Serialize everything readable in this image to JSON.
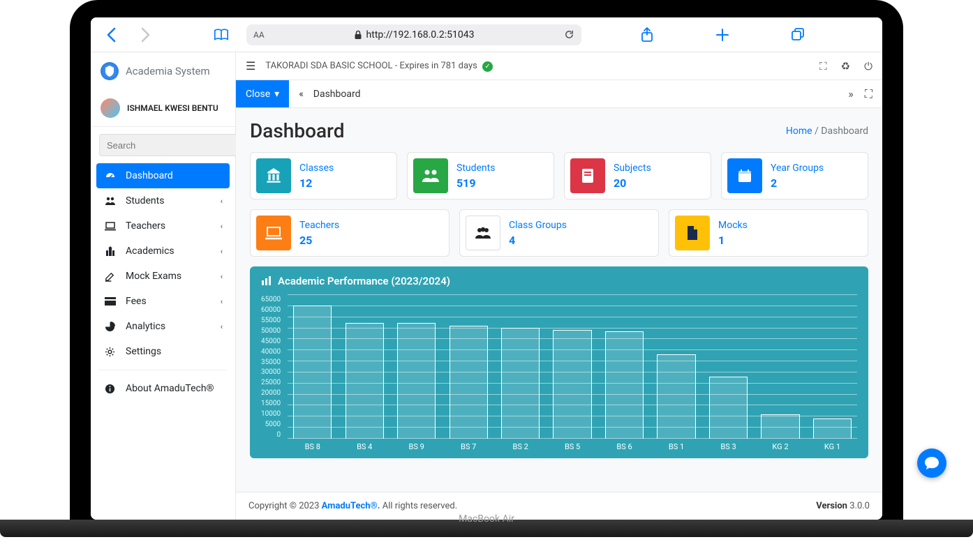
{
  "browser": {
    "url": "http://192.168.0.2:51043",
    "aa": "AA"
  },
  "brand": "Academia System",
  "user": "ISHMAEL KWESI BENTU",
  "search_placeholder": "Search",
  "menu": {
    "dashboard": "Dashboard",
    "students": "Students",
    "teachers": "Teachers",
    "academics": "Academics",
    "mock": "Mock Exams",
    "fees": "Fees",
    "analytics": "Analytics",
    "settings": "Settings",
    "about": "About AmaduTech®"
  },
  "topbar": {
    "school": "TAKORADI SDA BASIC SCHOOL",
    "expiry": "Expires in 781 days"
  },
  "crumb": {
    "close": "Close",
    "title": "Dashboard"
  },
  "page": {
    "title": "Dashboard",
    "home": "Home",
    "current": "Dashboard"
  },
  "stats": {
    "classes": {
      "label": "Classes",
      "value": "12"
    },
    "students": {
      "label": "Students",
      "value": "519"
    },
    "subjects": {
      "label": "Subjects",
      "value": "20"
    },
    "yeargroups": {
      "label": "Year Groups",
      "value": "2"
    },
    "teachers": {
      "label": "Teachers",
      "value": "25"
    },
    "classgroups": {
      "label": "Class Groups",
      "value": "4"
    },
    "mocks": {
      "label": "Mocks",
      "value": "1"
    }
  },
  "chart_title": "Academic Performance (2023/2024)",
  "chart_data": {
    "type": "bar",
    "title": "Academic Performance (2023/2024)",
    "xlabel": "",
    "ylabel": "",
    "ylim": [
      0,
      65000
    ],
    "y_ticks": [
      65000,
      60000,
      55000,
      50000,
      45000,
      40000,
      35000,
      30000,
      25000,
      20000,
      15000,
      10000,
      5000,
      0
    ],
    "categories": [
      "BS 8",
      "BS 4",
      "BS 9",
      "BS 7",
      "BS 2",
      "BS 5",
      "BS 6",
      "BS 1",
      "BS 3",
      "KG 2",
      "KG 1"
    ],
    "values": [
      60000,
      52000,
      52000,
      51000,
      50000,
      49000,
      48500,
      38000,
      28000,
      11000,
      9000
    ]
  },
  "footer": {
    "copyright": "Copyright © 2023 ",
    "company": "AmaduTech®.",
    "rights": " All rights reserved.",
    "version_label": "Version ",
    "version": "3.0.0"
  },
  "laptop": "MacBook Air"
}
